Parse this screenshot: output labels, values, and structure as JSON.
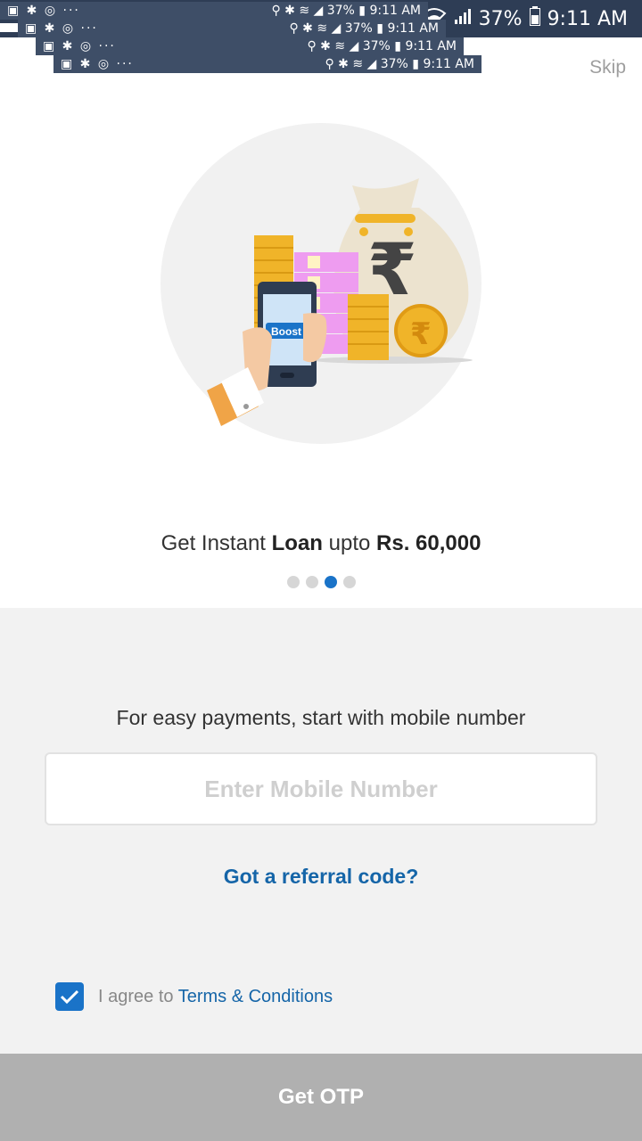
{
  "status_bar": {
    "battery": "37%",
    "time": "9:11 AM"
  },
  "glitch_rows": [
    {
      "left": "▣ ✱ ◎ ···",
      "right": "⚲ ✱ ≋ ◢ 37% ▮ 9:11 AM"
    },
    {
      "left": "▣ ✱ ◎ ···",
      "right": "⚲ ✱ ≋ ◢ 37% ▮ 9:11 AM"
    },
    {
      "left": "▣ ✱ ◎ ···",
      "right": "⚲ ✱ ≋ ◢ 37% ▮ 9:11 AM"
    },
    {
      "left": "▣ ✱ ◎ ···",
      "right": "⚲ ✱ ≋ ◢ 37% ▮ 9:11 AM"
    }
  ],
  "skip_label": "Skip",
  "illustration": {
    "phone_text": "Boost",
    "currency_symbol": "₹"
  },
  "headline": {
    "part1": "Get Instant ",
    "bold1": "Loan",
    "part2": " upto ",
    "bold2": "Rs. 60,000"
  },
  "pager": {
    "count": 4,
    "active_index": 2
  },
  "form": {
    "prompt": "For easy payments, start with mobile number",
    "mobile_placeholder": "Enter Mobile Number",
    "referral_link": "Got a referral code?",
    "agree_prefix": "I agree to ",
    "terms_link": "Terms & Conditions",
    "checkbox_checked": true
  },
  "otp_button": "Get OTP",
  "colors": {
    "accent": "#1a73c8",
    "link": "#1565a8",
    "status_bar": "#2e3d55",
    "button_disabled": "#b0b0b0"
  }
}
